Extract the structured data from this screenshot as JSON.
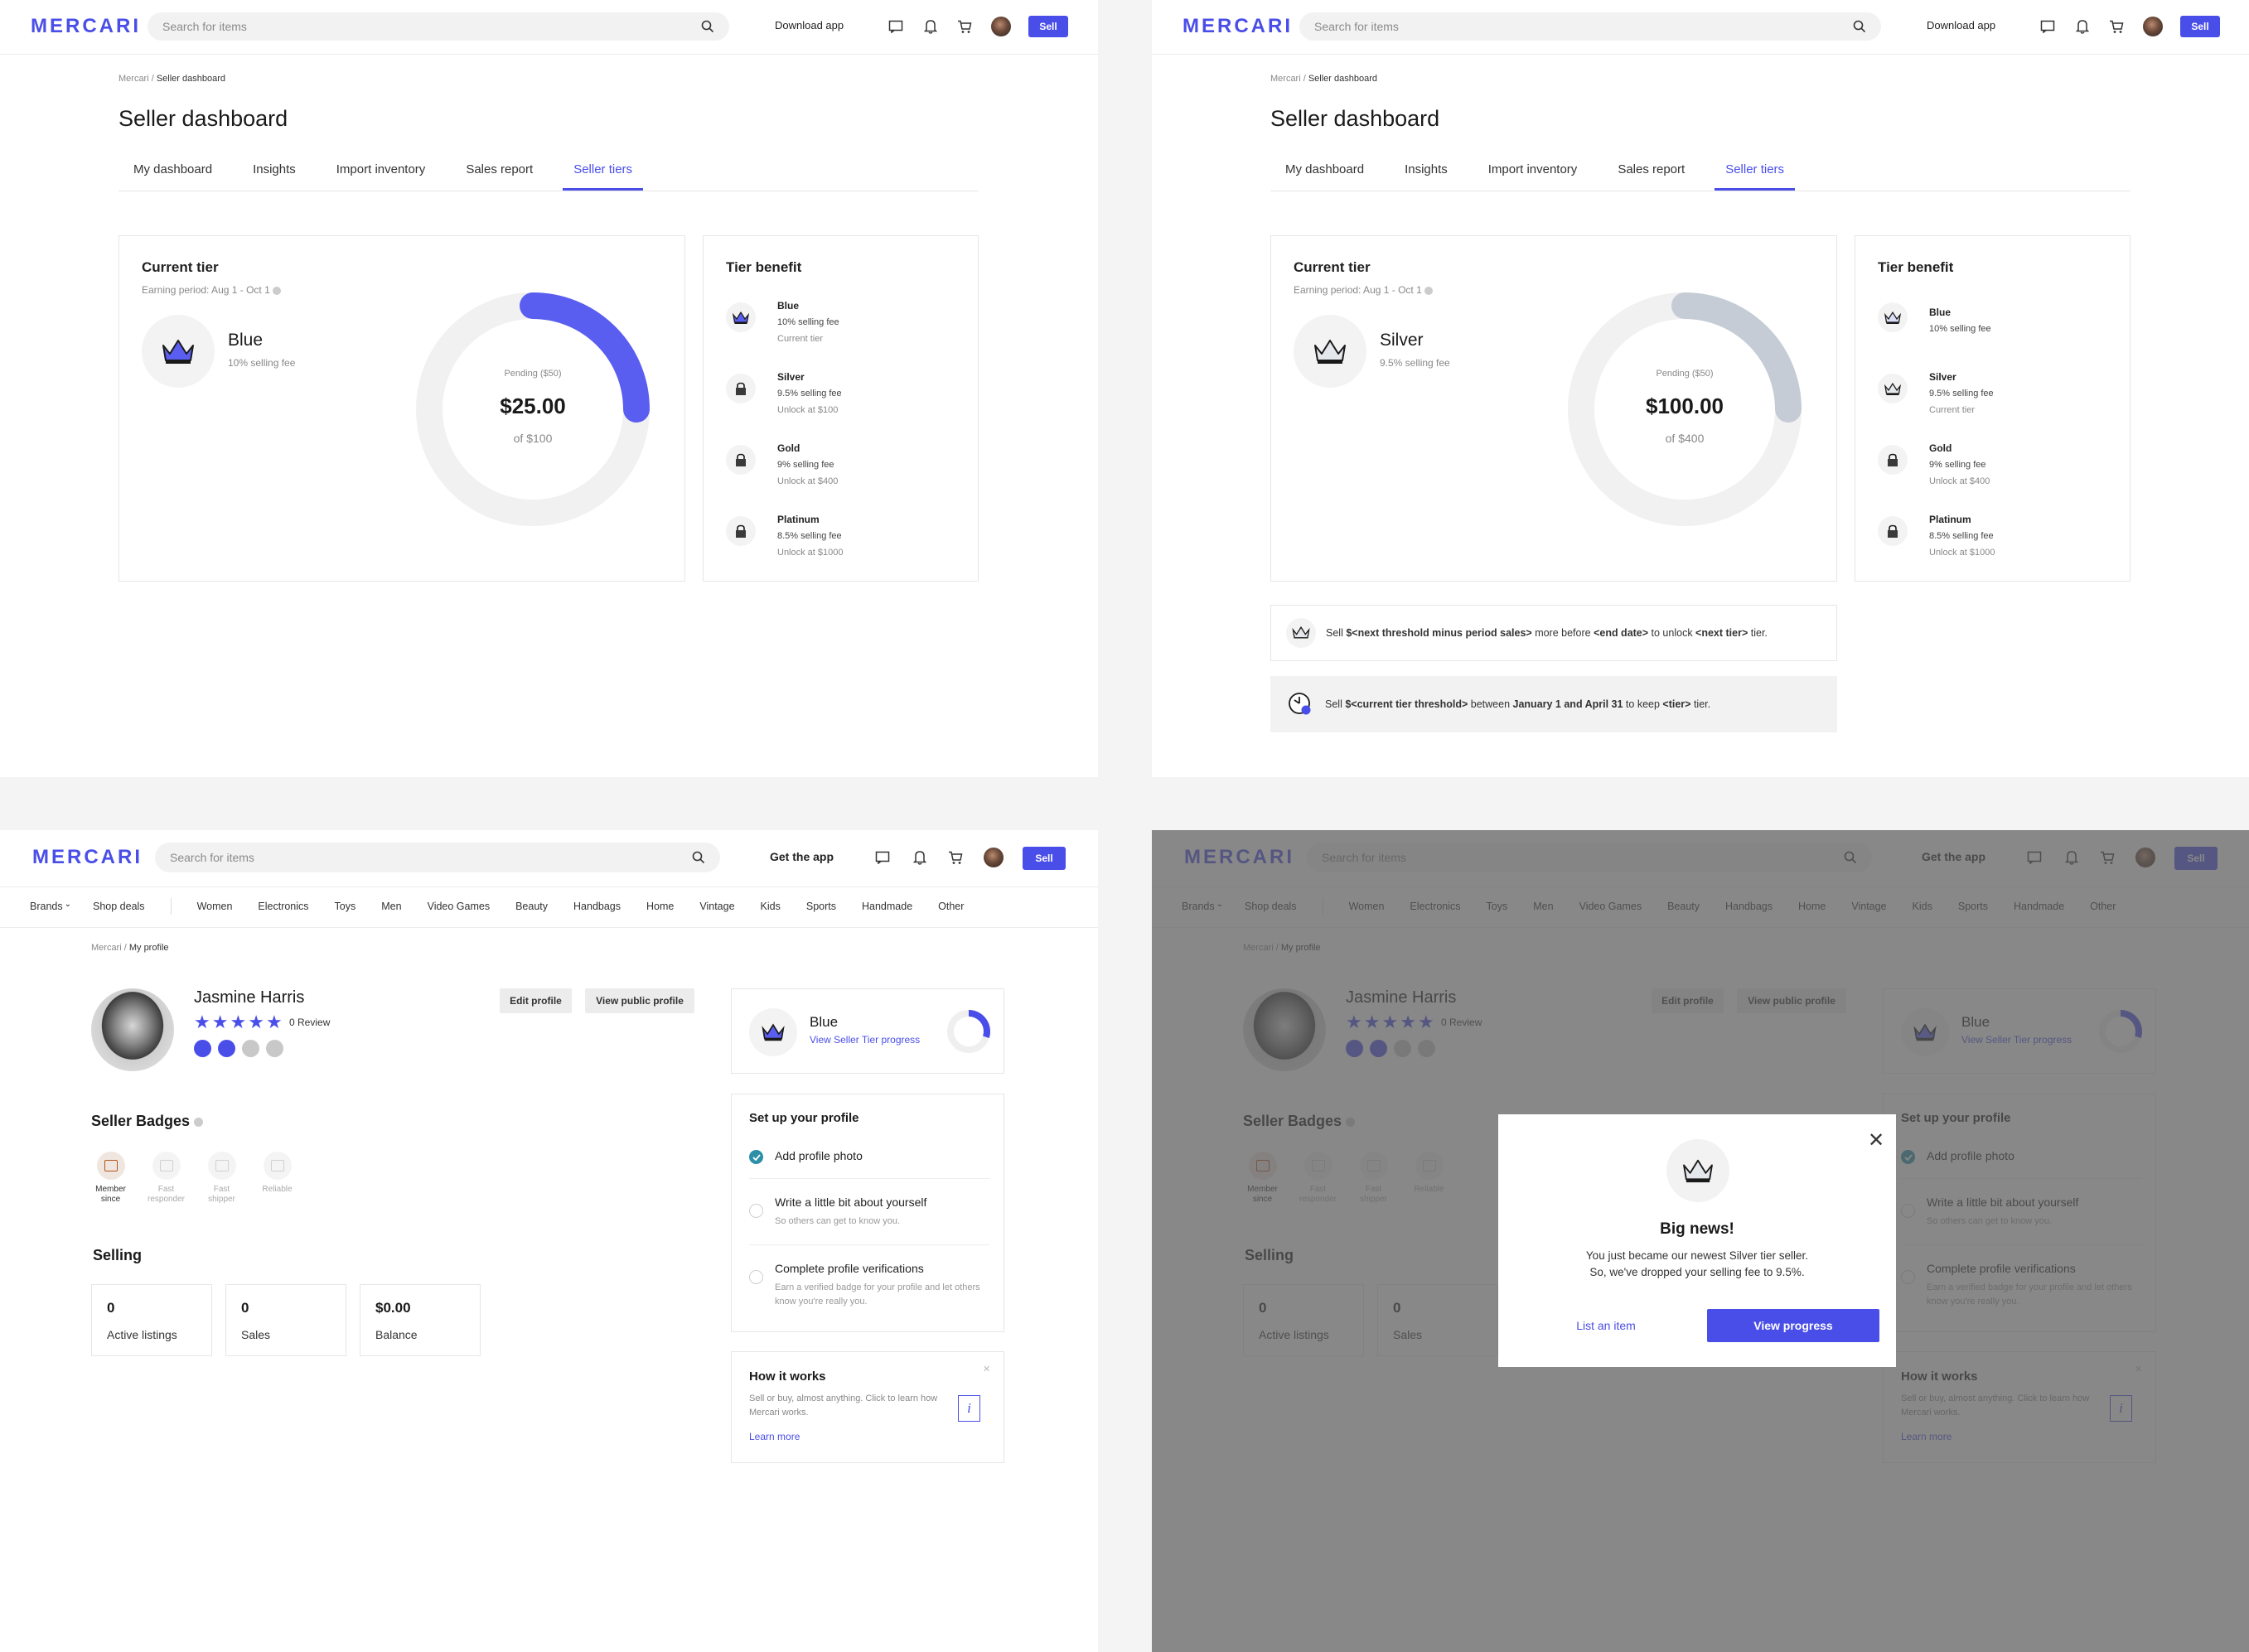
{
  "header": {
    "logo": "MERCARI",
    "search_placeholder": "Search for items",
    "download_label": "Download app",
    "get_app_label": "Get the app",
    "sell_label": "Sell"
  },
  "dashboard": {
    "breadcrumb_root": "Mercari",
    "breadcrumb_sep": " / ",
    "breadcrumb_current": "Seller dashboard",
    "title": "Seller dashboard",
    "tabs": [
      "My dashboard",
      "Insights",
      "Import inventory",
      "Sales report",
      "Seller tiers"
    ],
    "current_tier_label": "Current tier",
    "earning_period": "Earning period: Aug 1 - Oct 1",
    "tier_benefit_label": "Tier benefit",
    "pending": "Pending ($50)",
    "benefits": [
      {
        "name": "Blue",
        "fee": "10% selling fee",
        "unlock": "Current tier"
      },
      {
        "name": "Silver",
        "fee": "9.5% selling fee",
        "unlock": "Unlock at $100"
      },
      {
        "name": "Gold",
        "fee": "9% selling fee",
        "unlock": "Unlock at $400"
      },
      {
        "name": "Platinum",
        "fee": "8.5% selling fee",
        "unlock": "Unlock at $1000"
      }
    ],
    "benefits_silver": [
      {
        "name": "Blue",
        "fee": "10% selling fee",
        "unlock": ""
      },
      {
        "name": "Silver",
        "fee": "9.5% selling fee",
        "unlock": "Current tier"
      },
      {
        "name": "Gold",
        "fee": "9% selling fee",
        "unlock": "Unlock at $400"
      },
      {
        "name": "Platinum",
        "fee": "8.5% selling fee",
        "unlock": "Unlock at $1000"
      }
    ]
  },
  "panel1": {
    "tier_name": "Blue",
    "tier_fee": "10% selling fee",
    "amount": "$25.00",
    "of": "of $100",
    "progress": 0.25,
    "progress_color": "#5a5ef0"
  },
  "panel2": {
    "tier_name": "Silver",
    "tier_fee": "9.5% selling fee",
    "amount": "$100.00",
    "of": "of $400",
    "progress": 0.25,
    "progress_color": "#c5ccd6",
    "notice1": {
      "p1": "Sell ",
      "b1": "$<next threshold minus period sales>",
      "p2": " more before ",
      "b2": "<end date>",
      "p3": " to unlock ",
      "b3": "<next tier>",
      "p4": " tier."
    },
    "notice2": {
      "p1": "Sell ",
      "b1": "$<current tier threshold>",
      "p2": " between ",
      "b2": "January 1 and April 31",
      "p3": " to keep ",
      "b3": "<tier>",
      "p4": " tier."
    }
  },
  "profile": {
    "categories": [
      "Brands",
      "Shop deals",
      "Women",
      "Electronics",
      "Toys",
      "Men",
      "Video Games",
      "Beauty",
      "Handbags",
      "Home",
      "Vintage",
      "Kids",
      "Sports",
      "Handmade",
      "Other"
    ],
    "breadcrumb_root": "Mercari",
    "breadcrumb_sep": " / ",
    "breadcrumb_current": "My profile",
    "name": "Jasmine Harris",
    "rating": 5,
    "review_label": "0 Review",
    "edit_label": "Edit profile",
    "view_public_label": "View public profile",
    "tier_name": "Blue",
    "tier_link": "View Seller Tier progress",
    "tier_progress": 0.3,
    "badges_title": "Seller Badges",
    "badges": [
      {
        "l1": "Member",
        "l2": "since"
      },
      {
        "l1": "Fast",
        "l2": "responder"
      },
      {
        "l1": "Fast",
        "l2": "shipper"
      },
      {
        "l1": "Reliable",
        "l2": ""
      }
    ],
    "selling_title": "Selling",
    "stats": [
      {
        "value": "0",
        "label": "Active listings"
      },
      {
        "value": "0",
        "label": "Sales"
      },
      {
        "value": "$0.00",
        "label": "Balance"
      }
    ],
    "setup_title": "Set up your profile",
    "setup_items": [
      {
        "title": "Add profile photo",
        "desc": "",
        "done": true
      },
      {
        "title": "Write a little bit about yourself",
        "desc": "So others can get to know you.",
        "done": false
      },
      {
        "title": "Complete profile verifications",
        "desc": "Earn a verified badge for your profile and let others know you're really you.",
        "done": false
      }
    ],
    "how_title": "How it works",
    "how_desc": "Sell or buy, almost anything. Click to learn how Mercari works.",
    "learn_more": "Learn more"
  },
  "modal": {
    "title": "Big news!",
    "line1": "You just became our newest Silver tier seller.",
    "line2": "So, we've dropped your selling fee to 9.5%.",
    "list_item": "List an item",
    "view_progress": "View progress"
  },
  "colors": {
    "brand": "#4a4ee8",
    "check": "#2d8fa8",
    "overlay": "#5a5a5a"
  }
}
